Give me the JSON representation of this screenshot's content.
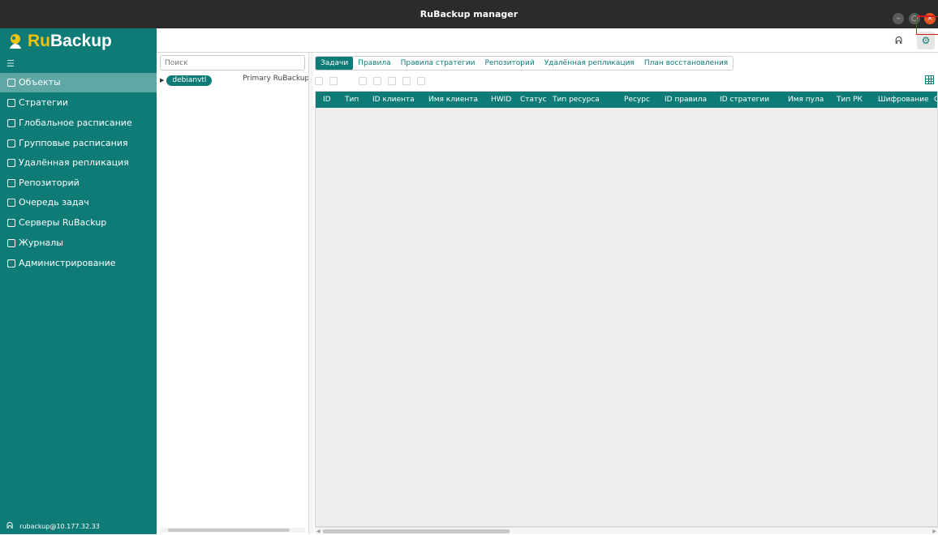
{
  "window": {
    "title": "RuBackup manager",
    "minimize_icon": "–",
    "maximize_icon": "○",
    "close_icon": "×"
  },
  "logo": {
    "ru": "Ru",
    "backup": "Backup"
  },
  "sidebar": {
    "collapse_icon": "☰",
    "items": [
      {
        "label": "Объекты",
        "icon": "monitor-icon",
        "active": true
      },
      {
        "label": "Стратегии",
        "icon": "strategy-icon"
      },
      {
        "label": "Глобальное расписание",
        "icon": "calendar-icon"
      },
      {
        "label": "Групповые расписания",
        "icon": "group-calendar-icon"
      },
      {
        "label": "Удалённая репликация",
        "icon": "replication-icon"
      },
      {
        "label": "Репозиторий",
        "icon": "repository-icon"
      },
      {
        "label": "Очередь задач",
        "icon": "queue-icon"
      },
      {
        "label": "Серверы RuBackup",
        "icon": "server-icon"
      },
      {
        "label": "Журналы",
        "icon": "log-icon"
      },
      {
        "label": "Администрирование",
        "icon": "admin-icon"
      }
    ],
    "footer_user": "rubackup@10.177.32.33",
    "footer_icon": "ᕱ"
  },
  "topbar": {
    "user_icon": "ᕱ",
    "settings_icon": "⚙"
  },
  "tree": {
    "search_placeholder": "Поиск",
    "node": {
      "arrow": "▶",
      "name": "debianvtl",
      "description": "Primary RuBackup se"
    }
  },
  "tabs": [
    {
      "label": "Задачи",
      "active": true
    },
    {
      "label": "Правила"
    },
    {
      "label": "Правила стратегии"
    },
    {
      "label": "Репозиторий"
    },
    {
      "label": "Удалённая репликация"
    },
    {
      "label": "План восстановления"
    }
  ],
  "table": {
    "columns": [
      "ID",
      "Тип",
      "ID клиента",
      "Имя клиента",
      "HWID",
      "Статус",
      "Тип ресурса",
      "Ресурс",
      "ID правила",
      "ID стратегии",
      "Имя пула",
      "Тип РК",
      "Шифрование",
      "С"
    ],
    "rows": []
  },
  "scroll": {
    "left": "◀",
    "right": "▶"
  },
  "colors": {
    "accent": "#0e7b77",
    "sidebar_active": "#5fa7a4",
    "brand_yellow": "#f3c20c",
    "annotation": "#d41c1c"
  }
}
